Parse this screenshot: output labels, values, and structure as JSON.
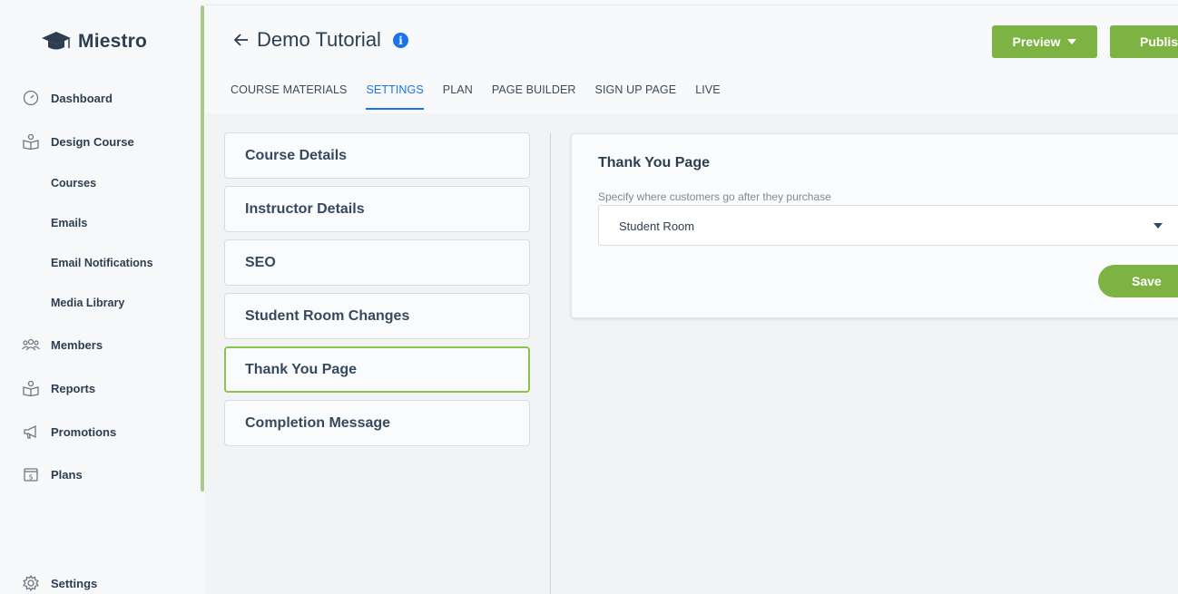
{
  "brand": {
    "name": "Miestro"
  },
  "sidebar": {
    "items": [
      {
        "label": "Dashboard",
        "icon": "dashboard-gauge-icon"
      },
      {
        "label": "Design Course",
        "icon": "book-reader-icon"
      },
      {
        "label": "Courses",
        "sub": true
      },
      {
        "label": "Emails",
        "sub": true
      },
      {
        "label": "Email Notifications",
        "sub": true
      },
      {
        "label": "Media Library",
        "sub": true
      },
      {
        "label": "Members",
        "icon": "members-group-icon"
      },
      {
        "label": "Reports",
        "icon": "reports-icon"
      },
      {
        "label": "Promotions",
        "icon": "megaphone-icon"
      },
      {
        "label": "Plans",
        "icon": "dollar-box-icon"
      },
      {
        "label": "Settings",
        "icon": "gear-icon"
      }
    ]
  },
  "header": {
    "title": "Demo Tutorial",
    "preview_label": "Preview",
    "publish_label": "Publis",
    "tabs": [
      {
        "label": "COURSE MATERIALS"
      },
      {
        "label": "SETTINGS",
        "active": true
      },
      {
        "label": "PLAN"
      },
      {
        "label": "PAGE BUILDER"
      },
      {
        "label": "SIGN UP PAGE"
      },
      {
        "label": "LIVE"
      }
    ]
  },
  "settings_menu": {
    "items": [
      {
        "label": "Course Details"
      },
      {
        "label": "Instructor Details"
      },
      {
        "label": "SEO"
      },
      {
        "label": "Student Room Changes"
      },
      {
        "label": "Thank You Page",
        "active": true
      },
      {
        "label": "Completion Message"
      }
    ]
  },
  "card": {
    "title": "Thank You Page",
    "field_label": "Specify where customers go after they purchase",
    "select_value": "Student Room",
    "save_label": "Save"
  },
  "colors": {
    "accent_green": "#7cb342",
    "active_blue": "#1a73e8",
    "sidebar_rail": "#a8cc86"
  }
}
